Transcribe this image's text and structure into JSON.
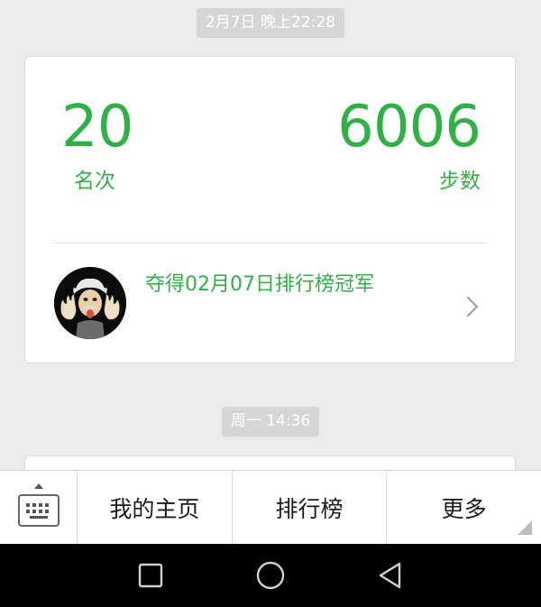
{
  "messages": [
    {
      "timestamp": "2月7日 晚上22:28",
      "rank_value": "20",
      "rank_label": "名次",
      "steps_value": "6006",
      "steps_label": "步数",
      "champion_text": "夺得02月07日排行榜冠军"
    },
    {
      "timestamp": "周一 14:36"
    }
  ],
  "menu": {
    "items": [
      "我的主页",
      "排行榜",
      "更多"
    ]
  },
  "colors": {
    "accent": "#2fb145",
    "background": "#ebebeb",
    "timestamp_bg": "#d5d5d5"
  },
  "icons": {
    "keyboard": "keyboard-icon",
    "chevron": "chevron-right-icon",
    "back": "back-icon",
    "home": "home-icon",
    "recents": "recents-icon"
  }
}
